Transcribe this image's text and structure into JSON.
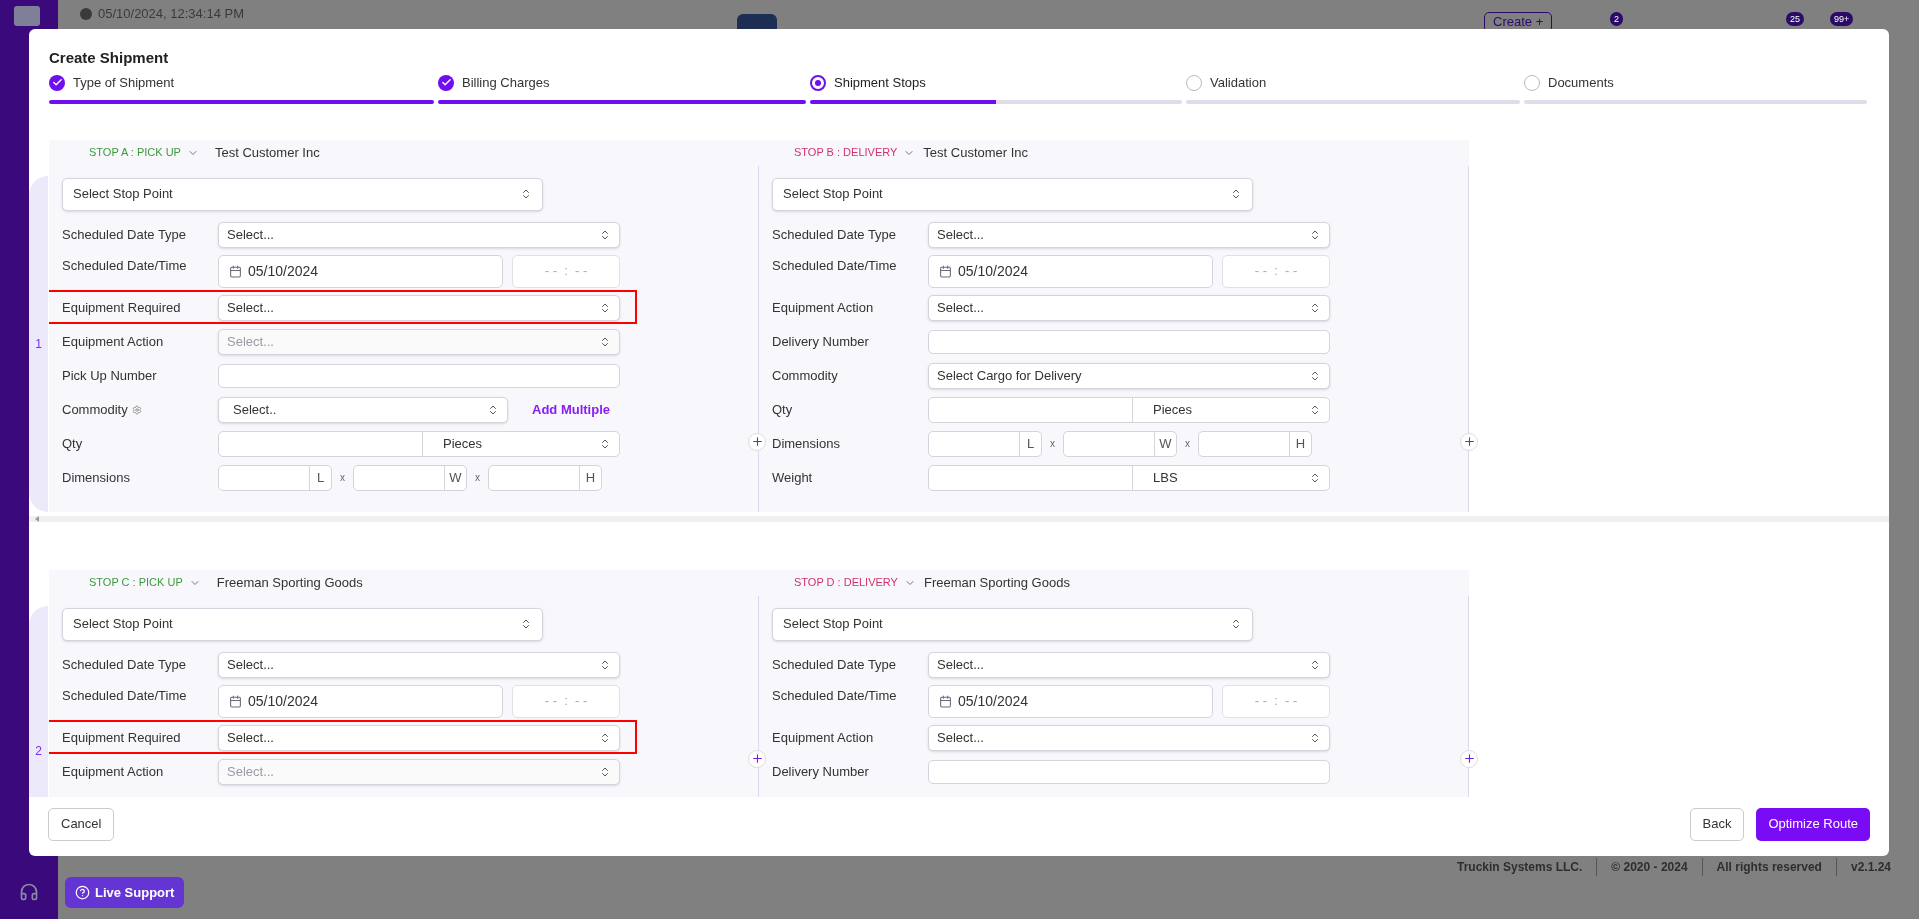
{
  "background": {
    "timestamp": "05/10/2024, 12:34:14 PM",
    "create_button": "Create +",
    "badges": [
      "2",
      "25",
      "99+"
    ],
    "footer": [
      "Truckin Systems LLC.",
      "© 2020 - 2024",
      "All rights reserved",
      "v2.1.24"
    ],
    "live_support": "Live Support"
  },
  "modal": {
    "title": "Create Shipment",
    "steps": [
      {
        "label": "Type of Shipment",
        "completed": true,
        "selected": false,
        "level": 1
      },
      {
        "label": "Billing Charges",
        "completed": true,
        "selected": false,
        "level": 1
      },
      {
        "label": "Shipment Stops",
        "completed": false,
        "selected": true,
        "level": 0.5
      },
      {
        "label": "Validation",
        "completed": false,
        "selected": false,
        "level": 0
      },
      {
        "label": "Documents",
        "completed": false,
        "selected": false,
        "level": 0
      }
    ],
    "groups": [
      {
        "number": "1",
        "stops": [
          {
            "kind": "pickup",
            "code": "STOP A : PICK UP",
            "customer": "Test Customer Inc",
            "stop_point": "Select Stop Point",
            "fields": [
              {
                "label": "Scheduled Date Type",
                "kind": "select",
                "placeholder": "Select...",
                "disabled": false,
                "highlighted": false
              },
              {
                "label": "Scheduled Date/Time",
                "kind": "date",
                "value": "05/10/2024",
                "time_placeholder": "- -  :  - -",
                "disabled": false,
                "highlighted": false
              },
              {
                "label": "Equipment Required",
                "kind": "select",
                "placeholder": "Select...",
                "disabled": false,
                "highlighted": true
              },
              {
                "label": "Equipment Action",
                "kind": "select",
                "placeholder": "Select...",
                "disabled": true,
                "highlighted": false
              },
              {
                "label": "Pick Up Number",
                "kind": "input",
                "disabled": false,
                "highlighted": false
              },
              {
                "label": "Commodity",
                "kind": "commodity",
                "placeholder": "Select..",
                "link": "Add Multiple",
                "disabled": false,
                "highlighted": false
              },
              {
                "label": "Qty",
                "kind": "qty",
                "unit": "Pieces",
                "disabled": false,
                "highlighted": false
              },
              {
                "label": "Dimensions",
                "kind": "dims",
                "units": [
                  "L",
                  "W",
                  "H"
                ],
                "separators": [
                  "x",
                  "x"
                ],
                "disabled": false,
                "highlighted": false
              }
            ]
          },
          {
            "kind": "delivery",
            "code": "STOP B : DELIVERY",
            "customer": "Test Customer Inc",
            "stop_point": "Select Stop Point",
            "fields": [
              {
                "label": "Scheduled Date Type",
                "kind": "select",
                "placeholder": "Select...",
                "disabled": false,
                "highlighted": false
              },
              {
                "label": "Scheduled Date/Time",
                "kind": "date",
                "value": "05/10/2024",
                "time_placeholder": "- -  :  - -",
                "disabled": false,
                "highlighted": false
              },
              {
                "label": "Equipment Action",
                "kind": "select",
                "placeholder": "Select...",
                "disabled": false,
                "highlighted": false
              },
              {
                "label": "Delivery Number",
                "kind": "input",
                "disabled": false,
                "highlighted": false
              },
              {
                "label": "Commodity",
                "kind": "select",
                "placeholder": "Select Cargo for Delivery",
                "disabled": false,
                "highlighted": false
              },
              {
                "label": "Qty",
                "kind": "qty",
                "unit": "Pieces",
                "disabled": false,
                "highlighted": false
              },
              {
                "label": "Dimensions",
                "kind": "dims",
                "units": [
                  "L",
                  "W",
                  "H"
                ],
                "separators": [
                  "x",
                  "x"
                ],
                "disabled": false,
                "highlighted": false
              },
              {
                "label": "Weight",
                "kind": "qty",
                "unit": "LBS",
                "disabled": false,
                "highlighted": false
              }
            ]
          }
        ]
      },
      {
        "number": "2",
        "stops": [
          {
            "kind": "pickup",
            "code": "STOP C : PICK UP",
            "customer": "Freeman Sporting Goods",
            "stop_point": "Select Stop Point",
            "fields": [
              {
                "label": "Scheduled Date Type",
                "kind": "select",
                "placeholder": "Select...",
                "disabled": false,
                "highlighted": false
              },
              {
                "label": "Scheduled Date/Time",
                "kind": "date",
                "value": "05/10/2024",
                "time_placeholder": "- -  :  - -",
                "disabled": false,
                "highlighted": false
              },
              {
                "label": "Equipment Required",
                "kind": "select",
                "placeholder": "Select...",
                "disabled": false,
                "highlighted": true
              },
              {
                "label": "Equipment Action",
                "kind": "select",
                "placeholder": "Select...",
                "disabled": true,
                "highlighted": false
              }
            ]
          },
          {
            "kind": "delivery",
            "code": "STOP D : DELIVERY",
            "customer": "Freeman Sporting Goods",
            "stop_point": "Select Stop Point",
            "fields": [
              {
                "label": "Scheduled Date Type",
                "kind": "select",
                "placeholder": "Select...",
                "disabled": false,
                "highlighted": false
              },
              {
                "label": "Scheduled Date/Time",
                "kind": "date",
                "value": "05/10/2024",
                "time_placeholder": "- -  :  - -",
                "disabled": false,
                "highlighted": false
              },
              {
                "label": "Equipment Action",
                "kind": "select",
                "placeholder": "Select...",
                "disabled": false,
                "highlighted": false
              },
              {
                "label": "Delivery Number",
                "kind": "input",
                "disabled": false,
                "highlighted": false
              }
            ]
          }
        ]
      }
    ],
    "buttons": {
      "cancel": "Cancel",
      "back": "Back",
      "primary": "Optimize Route"
    }
  }
}
